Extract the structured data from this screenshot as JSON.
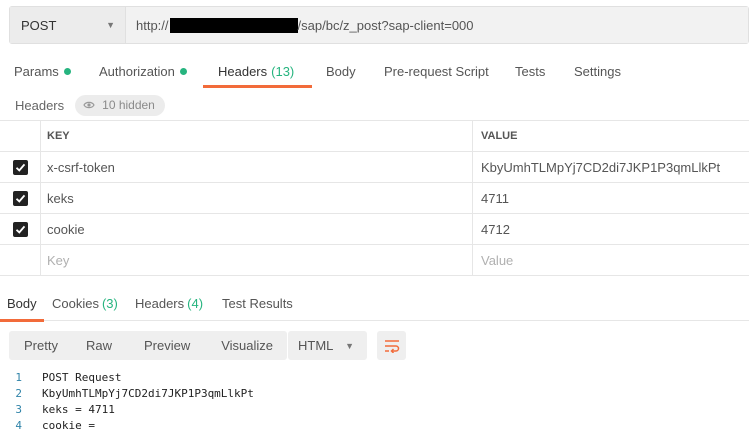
{
  "request": {
    "method": "POST",
    "url_prefix": "http://",
    "url_suffix": "/sap/bc/z_post?sap-client=000"
  },
  "request_tabs": [
    {
      "label": "Params",
      "has_dot": true
    },
    {
      "label": "Authorization",
      "has_dot": true
    },
    {
      "label": "Headers",
      "count": "(13)",
      "active": true
    },
    {
      "label": "Body"
    },
    {
      "label": "Pre-request Script"
    },
    {
      "label": "Tests"
    },
    {
      "label": "Settings"
    }
  ],
  "headers_section": {
    "title": "Headers",
    "hidden_label": "10 hidden"
  },
  "headers_table": {
    "columns": {
      "key": "KEY",
      "value": "VALUE"
    },
    "rows": [
      {
        "key": "x-csrf-token",
        "value": "KbyUmhTLMpYj7CD2di7JKP1P3qmLlkPt",
        "checked": true
      },
      {
        "key": "keks",
        "value": "4711",
        "checked": true
      },
      {
        "key": "cookie",
        "value": "4712",
        "checked": true
      }
    ],
    "new_row": {
      "key_placeholder": "Key",
      "value_placeholder": "Value"
    }
  },
  "response_tabs": [
    {
      "label": "Body",
      "active": true
    },
    {
      "label": "Cookies",
      "count": "(3)"
    },
    {
      "label": "Headers",
      "count": "(4)"
    },
    {
      "label": "Test Results"
    }
  ],
  "format_toolbar": {
    "buttons": [
      "Pretty",
      "Raw",
      "Preview",
      "Visualize"
    ],
    "language": "HTML"
  },
  "response_body": [
    {
      "n": "1",
      "text": "POST Request"
    },
    {
      "n": "2",
      "text": "KbyUmhTLMpYj7CD2di7JKP1P3qmLlkPt"
    },
    {
      "n": "3",
      "text": "keks = 4711"
    },
    {
      "n": "4",
      "text": "cookie ="
    }
  ],
  "colors": {
    "accent": "#f26b3a",
    "green": "#26b47f",
    "line_number": "#2f83a8"
  }
}
